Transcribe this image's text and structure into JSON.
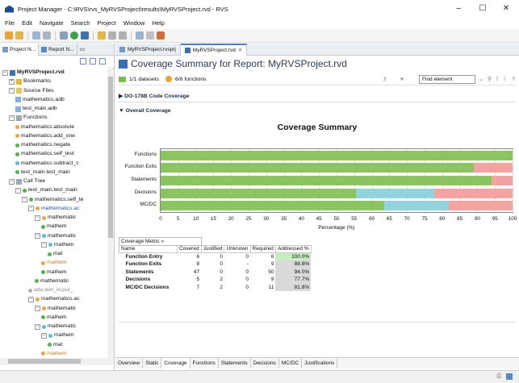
{
  "window": {
    "title": "Project Manager - C:\\RVS\\rvs_MyRVSProject\\results\\MyRVSProject.rvd - RVS",
    "minimize": "–",
    "maximize": "☐",
    "close": "✕"
  },
  "menu": [
    "File",
    "Edit",
    "Navigate",
    "Search",
    "Project",
    "Window",
    "Help"
  ],
  "left_tabs": [
    "Project N...",
    "Report N..."
  ],
  "tree": [
    {
      "label": "MyRVSProject.rvd",
      "level": 0,
      "exp": "−",
      "icon": "rvd-icon",
      "bold": true
    },
    {
      "label": "Bookmarks",
      "level": 1,
      "exp": "+",
      "icon": "star-icon"
    },
    {
      "label": "Source Files",
      "level": 1,
      "exp": "−",
      "icon": "folder-icon"
    },
    {
      "label": "mathematics.adb",
      "level": 2,
      "exp": "",
      "icon": "file-icon"
    },
    {
      "label": "test_main.adb",
      "level": 2,
      "exp": "",
      "icon": "file-icon"
    },
    {
      "label": "Functions",
      "level": 1,
      "exp": "−",
      "icon": "functions-icon"
    },
    {
      "label": "mathematics.absolute",
      "level": 2,
      "exp": "",
      "icon": "orange-dot"
    },
    {
      "label": "mathematics.add_one",
      "level": 2,
      "exp": "",
      "icon": "orange-dot"
    },
    {
      "label": "mathematics.negate",
      "level": 2,
      "exp": "",
      "icon": "green-dot"
    },
    {
      "label": "mathematics.self_test",
      "level": 2,
      "exp": "",
      "icon": "green-dot"
    },
    {
      "label": "mathematics.subtract_c",
      "level": 2,
      "exp": "",
      "icon": "teal-dot"
    },
    {
      "label": "test_main.test_main",
      "level": 2,
      "exp": "",
      "icon": "green-dot"
    },
    {
      "label": "Call Tree",
      "level": 1,
      "exp": "−",
      "icon": "calltree-icon"
    },
    {
      "label": "test_main.test_main",
      "level": 2,
      "exp": "−",
      "icon": "green-dot"
    },
    {
      "label": "mathematics.self_te",
      "level": 3,
      "exp": "−",
      "icon": "green-dot"
    },
    {
      "label": "mathematics.ac",
      "level": 4,
      "exp": "−",
      "icon": "orange-dot",
      "link": true
    },
    {
      "label": "mathematic",
      "level": 5,
      "exp": "−",
      "icon": "orange-dot"
    },
    {
      "label": "mathem",
      "level": 6,
      "exp": "",
      "icon": "green-dot"
    },
    {
      "label": "mathematic",
      "level": 5,
      "exp": "−",
      "icon": "teal-dot"
    },
    {
      "label": "mathem",
      "level": 6,
      "exp": "−",
      "icon": "teal-dot"
    },
    {
      "label": "mat",
      "level": 7,
      "exp": "",
      "icon": "green-dot"
    },
    {
      "label": "mathem",
      "level": 6,
      "exp": "",
      "icon": "orange-dot",
      "muted": true
    },
    {
      "label": "mathem",
      "level": 6,
      "exp": "",
      "icon": "green-dot"
    },
    {
      "label": "mathematic",
      "level": 5,
      "exp": "",
      "icon": "green-dot"
    },
    {
      "label": "ada.text_io.put_",
      "level": 4,
      "exp": "",
      "icon": "gray-dot",
      "muted": true
    },
    {
      "label": "mathematics.ac",
      "level": 4,
      "exp": "−",
      "icon": "orange-dot"
    },
    {
      "label": "mathematic",
      "level": 5,
      "exp": "−",
      "icon": "orange-dot"
    },
    {
      "label": "mathem",
      "level": 6,
      "exp": "",
      "icon": "green-dot"
    },
    {
      "label": "mathematic",
      "level": 5,
      "exp": "−",
      "icon": "teal-dot"
    },
    {
      "label": "mathem",
      "level": 6,
      "exp": "−",
      "icon": "teal-dot"
    },
    {
      "label": "mat",
      "level": 7,
      "exp": "",
      "icon": "green-dot"
    },
    {
      "label": "mathem",
      "level": 6,
      "exp": "",
      "icon": "orange-dot",
      "muted": true
    }
  ],
  "editor_tabs": [
    "MyRVSProject.rvsprj",
    "MyRVSProject.rvd"
  ],
  "report": {
    "title": "Coverage Summary for Report: MyRVSProject.rvd",
    "datasets": "1/1 datasets",
    "functions": "6/6 functions",
    "find_label": "Find element",
    "sections": [
      "DO-178B Code Coverage",
      "Overall Coverage"
    ],
    "section_arrows": [
      "▶",
      "▼"
    ]
  },
  "chart_data": {
    "type": "bar",
    "orientation": "horizontal",
    "stacked": true,
    "title": "Coverage Summary",
    "xlabel": "Percentage (%)",
    "ylabel": "",
    "xlim": [
      0,
      100
    ],
    "xticks": [
      "0",
      "5",
      "10",
      "15",
      "20",
      "25",
      "30",
      "35",
      "40",
      "45",
      "50",
      "55",
      "60",
      "65",
      "70",
      "75",
      "80",
      "85",
      "90",
      "95",
      "100"
    ],
    "categories": [
      "Functions",
      "Function Exits",
      "Statements",
      "Decisions",
      "MC/DC"
    ],
    "series": [
      {
        "color": "#8cc461",
        "values": [
          100,
          88.9,
          94.0,
          55.6,
          63.6
        ]
      },
      {
        "color": "#93d3de",
        "values": [
          0,
          0,
          0,
          22.2,
          18.2
        ]
      },
      {
        "color": "#f4a3a3",
        "values": [
          0,
          11.1,
          6.0,
          22.2,
          18.2
        ]
      }
    ],
    "grid": true
  },
  "table": {
    "metric_header": "Coverage Metric",
    "metric_chevrons": "»",
    "columns": [
      "Name",
      "Covered",
      "Justified",
      "Unknown",
      "Required",
      "Addressed %"
    ],
    "rows": [
      [
        "Function Entry",
        "6",
        "0",
        "0",
        "6",
        "100.0%"
      ],
      [
        "Function Exits",
        "8",
        "0",
        "-",
        "9",
        "88.8%"
      ],
      [
        "Statements",
        "47",
        "0",
        "0",
        "50",
        "94.0%"
      ],
      [
        "Decisions",
        "5",
        "2",
        "0",
        "9",
        "77.7%"
      ],
      [
        "MC/DC Decisions",
        "7",
        "2",
        "0",
        "11",
        "81.8%"
      ]
    ]
  },
  "bottom_tabs": [
    "Overview",
    "Static",
    "Coverage",
    "Functions",
    "Statements",
    "Decisions",
    "MC/DC",
    "Justifications"
  ],
  "active_bottom_tab": "Coverage"
}
